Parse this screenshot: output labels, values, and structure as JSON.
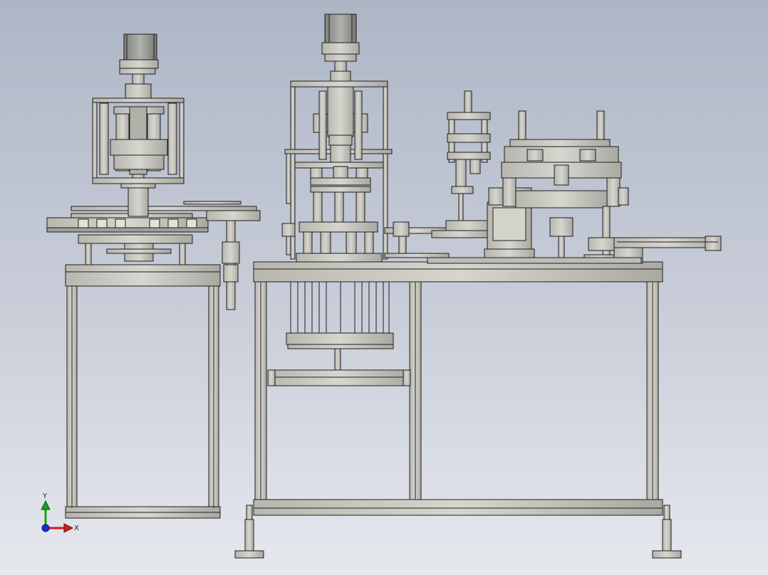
{
  "viewport": {
    "background_top": "#aeb6c6",
    "background_bottom": "#e6e8ee",
    "part_color": "#c4c4bc",
    "edge_color": "#1e1e1e",
    "motor_color": "#9a9c97"
  },
  "triad": {
    "y_label": "Y",
    "x_label": "X",
    "y_color": "#19a019",
    "x_color": "#d01a1a",
    "z_color": "#1a2fd0"
  }
}
